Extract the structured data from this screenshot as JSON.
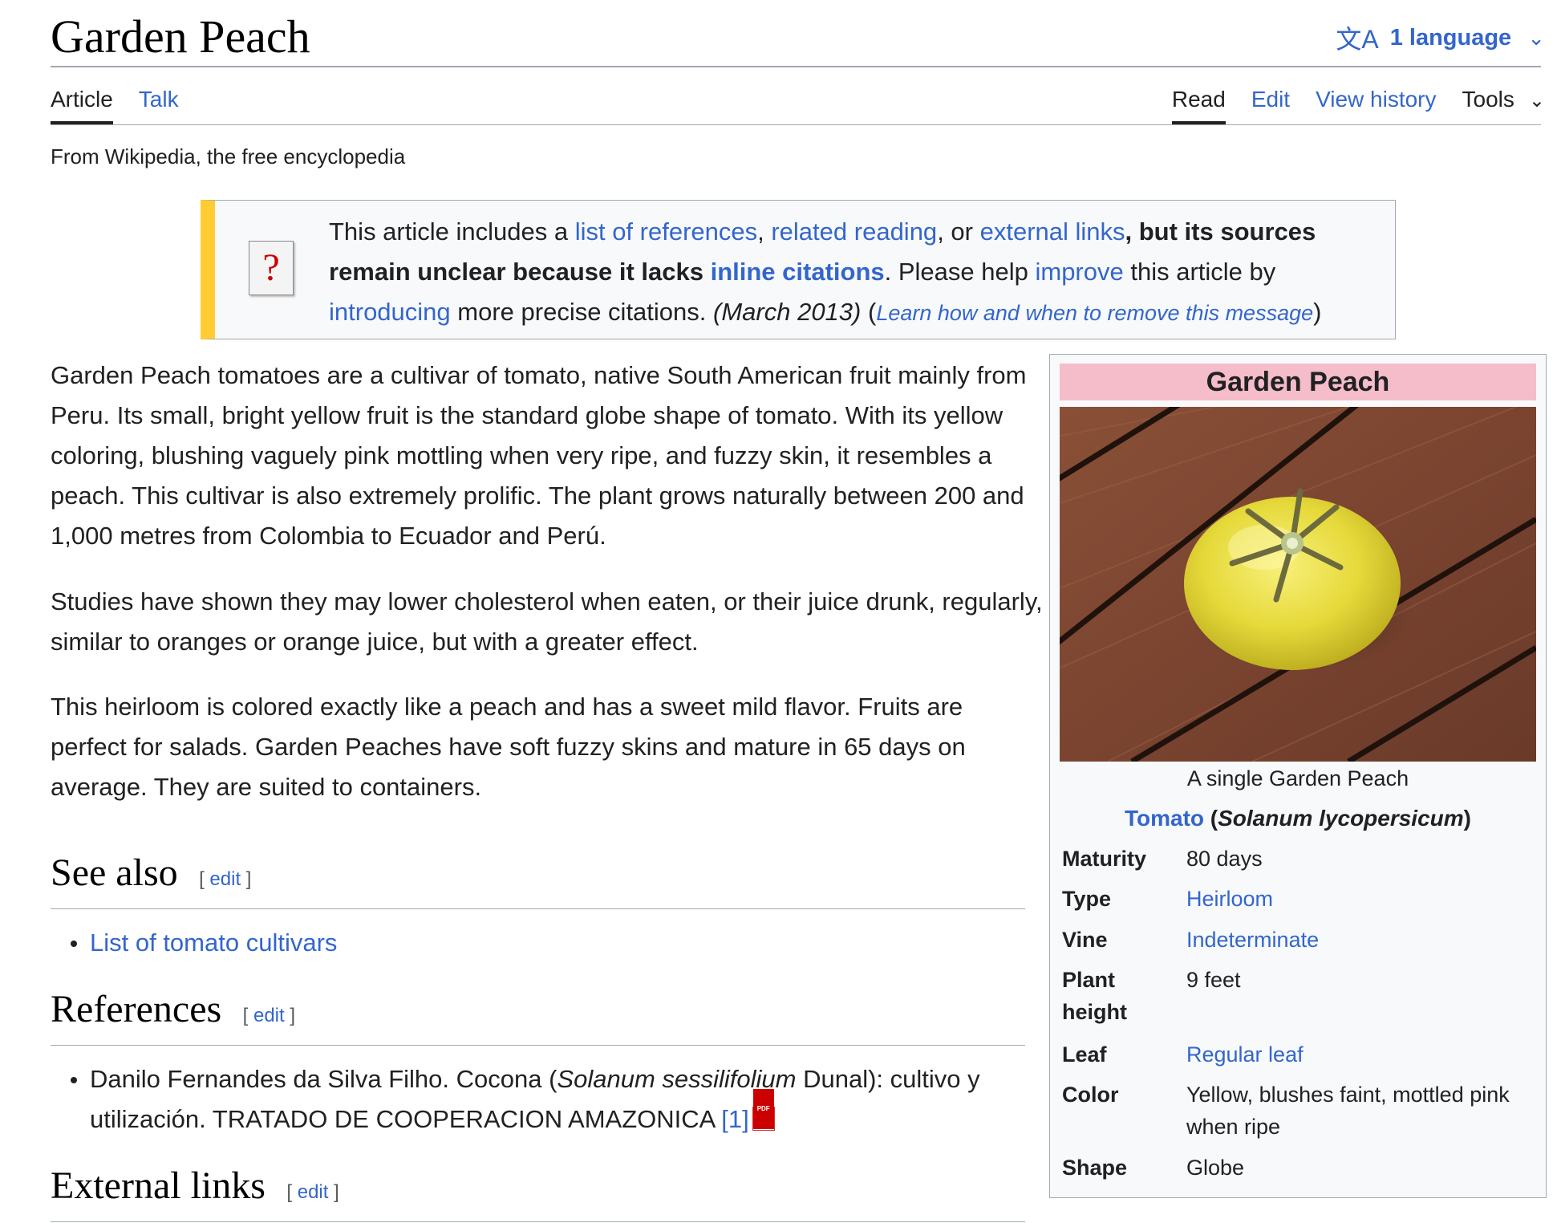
{
  "page": {
    "title": "Garden Peach",
    "language_label": "1 language",
    "tagline": "From Wikipedia, the free encyclopedia"
  },
  "tabs_left": [
    {
      "label": "Article"
    },
    {
      "label": "Talk"
    }
  ],
  "tabs_right": [
    {
      "label": "Read"
    },
    {
      "label": "Edit"
    },
    {
      "label": "View history"
    },
    {
      "label": "Tools"
    }
  ],
  "ambox": {
    "t1": "This article includes a ",
    "l1": "list of references",
    "t2": ", ",
    "l2": "related reading",
    "t3": ", or ",
    "l3": "external links",
    "b1": ", but its sources remain unclear because it lacks ",
    "bl1": "inline citations",
    "t4": ". Please help ",
    "l4": "improve",
    "t5": " this article by ",
    "l5": "introducing",
    "t6": " more precise citations. ",
    "date": "(March 2013)",
    "t7": " (",
    "l6": "Learn how and when to remove this message",
    "t8": ")"
  },
  "paragraphs": [
    "Garden Peach tomatoes are a cultivar of tomato, native South American fruit mainly from Peru. Its small, bright yellow fruit is the standard globe shape of tomato. With its yellow coloring, blushing vaguely pink mottling when very ripe, and fuzzy skin, it resembles a peach. This cultivar is also extremely prolific. The plant grows naturally between 200 and 1,000 metres from Colombia to Ecuador and Perú.",
    "Studies have shown they may lower cholesterol when eaten, or their juice drunk, regularly, similar to oranges or orange juice, but with a greater effect.",
    "This heirloom is colored exactly like a peach and has a sweet mild flavor. Fruits are perfect for salads. Garden Peaches have soft fuzzy skins and mature in 65 days on average. They are suited to containers."
  ],
  "sections": {
    "see_also": {
      "title": "See also",
      "edit_label": "edit",
      "items": [
        "List of tomato cultivars"
      ]
    },
    "references": {
      "title": "References",
      "edit_label": "edit",
      "ref1": {
        "pre": "Danilo Fernandes da Silva Filho. Cocona (",
        "italic": "Solanum sessilifolium",
        "post": " Dunal): cultivo y utilización. TRATADO DE COOPERACION AMAZONICA ",
        "link": "[1]"
      }
    },
    "external_links": {
      "title": "External links",
      "edit_label": "edit"
    }
  },
  "infobox": {
    "title": "Garden Peach",
    "caption": "A single Garden Peach",
    "species_link": "Tomato",
    "species_open": " (",
    "species_italic": "Solanum lycopersicum",
    "species_close": ")",
    "rows": [
      {
        "key": "Maturity",
        "value": "80 days"
      },
      {
        "key": "Type",
        "value": "Heirloom"
      },
      {
        "key": "Vine",
        "value": "Indeterminate"
      },
      {
        "key": "Plant height",
        "value": "9 feet"
      },
      {
        "key": "Leaf",
        "value": "Regular leaf"
      },
      {
        "key": "Color",
        "value": "Yellow, blushes faint, mottled pink when ripe"
      },
      {
        "key": "Shape",
        "value": "Globe"
      }
    ]
  },
  "colors": {
    "link": "#3366cc",
    "ambox_stripe": "#ffcc33",
    "infobox_header": "#f5bcc9"
  }
}
